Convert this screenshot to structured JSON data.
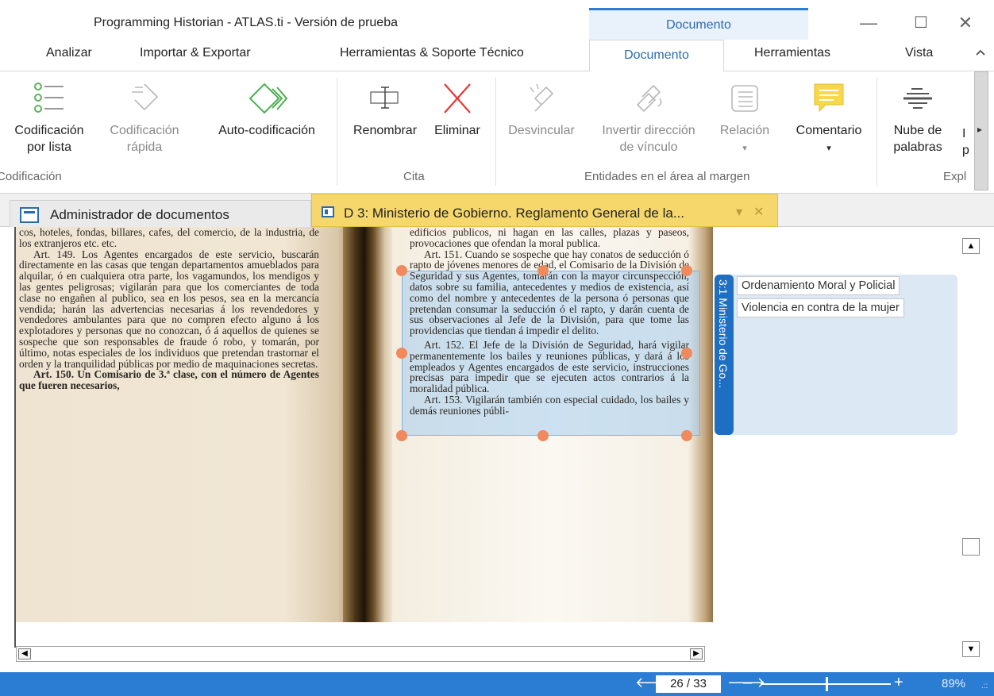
{
  "window": {
    "title": "Programming Historian - ATLAS.ti - Versión de prueba",
    "context_tab": "Documento",
    "minimize": "—",
    "maximize": "☐",
    "close": "✕"
  },
  "menu": {
    "tabs": [
      "Analizar",
      "Importar & Exportar",
      "Herramientas & Soporte Técnico",
      "Documento",
      "Herramientas",
      "Vista"
    ],
    "active": "Documento",
    "collapse_icon": "chevron-up-icon"
  },
  "ribbon": {
    "buttons": [
      {
        "line1": "Codificación",
        "line2": "por lista",
        "icon": "code-list-icon"
      },
      {
        "line1": "Codificación",
        "line2": "rápida",
        "icon": "quick-code-icon"
      },
      {
        "line1": "Auto-codificación",
        "line2": "",
        "icon": "auto-code-icon"
      },
      {
        "line1": "Renombrar",
        "line2": "",
        "icon": "rename-icon"
      },
      {
        "line1": "Eliminar",
        "line2": "",
        "icon": "delete-icon"
      },
      {
        "line1": "Desvincular",
        "line2": "",
        "icon": "unlink-icon"
      },
      {
        "line1": "Invertir dirección",
        "line2": "de vínculo",
        "icon": "reverse-link-icon"
      },
      {
        "line1": "Relación",
        "line2": "▾",
        "icon": "relation-icon"
      },
      {
        "line1": "Comentario",
        "line2": "▾",
        "icon": "comment-icon"
      },
      {
        "line1": "Nube de",
        "line2": "palabras",
        "icon": "word-cloud-icon"
      },
      {
        "line1": "I",
        "line2": "p",
        "icon": ""
      }
    ],
    "groups": [
      "Codificación",
      "Cita",
      "Entidades en el área al margen",
      "Expl"
    ],
    "more": "▸"
  },
  "doc_tabs": {
    "manager": "Administrador de documentos",
    "document": "D 3: Ministerio de Gobierno. Reglamento General de la...",
    "dropdown": "▾",
    "close": "✕"
  },
  "document": {
    "left_column": [
      "cos, hoteles, fondas, billares, cafes, del comercio, de la industria, de los extranjeros etc. etc.",
      "Art. 149. Los Agentes encargados de este servicio, buscarán directamente en las casas que tengan departamentos amueblados para alquilar, ó en cualquiera otra parte, los vagamundos, los mendigos y las gentes peligrosas; vigilarán para que los comerciantes de toda clase no engañen al publico, sea en los pesos, sea en la mercancía vendida; harán las advertencias necesarias á los revendedores y vendedores ambulantes para que no compren efecto alguno á los explotadores y personas que no conozcan, ó á aquellos de quienes se sospeche que son responsables de fraude ó robo, y tomarán, por último, notas especiales de los individuos que pretendan trastornar el orden y la tranquilidad públicas por medio de maquinaciones secretas.",
      "Art. 150. Un Comisario de 3.ª clase, con el número de Agentes que fueren necesarios,"
    ],
    "right_column": [
      "edificios publicos, ni hagan en las calles, plazas y paseos, provocaciones que ofendan la moral publica.",
      "Art. 151. Cuando se sospeche que hay conatos de seducción ó rapto de jóvenes menores de edad, el Comisario de la División de Seguridad y sus Agentes, tomarán con la mayor circunspección, datos sobre su familia, antecedentes y medios de existencia, así como del nombre y antecedentes de la persona ó personas que pretendan consumar la seducción ó el rapto, y darán cuenta de sus observaciones al Jefe de la División, para que tome las providencias que tiendan á impedir el delito.",
      "Art. 152. El Jefe de la División de Seguridad, hará vigilar permanentemente los bailes y reuniones públicas, y dará á los empleados y Agentes encargados de este servicio, instrucciones precisas para impedir que se ejecuten actos contrarios á la moralidad pública.",
      "Art. 153. Vigilarán también con especial cuidado, los bailes y demás reuniones públi-"
    ]
  },
  "margin": {
    "quotation_label": "3:1 Ministerio de Go...",
    "codes": [
      "Ordenamiento Moral y Policial",
      "Violencia en contra de la mujer"
    ],
    "colors": {
      "quotation": "#1e6fc2",
      "band": "#dce8f3",
      "handle": "#f08a5d"
    }
  },
  "scroll": {
    "left": "◀",
    "right": "▶",
    "up": "▲",
    "down": "▼"
  },
  "status": {
    "prev": "🡐",
    "page": "26 / 33",
    "next": "🡒",
    "zoom_minus": "–",
    "zoom_plus": "+",
    "zoom": "89%",
    "zoom_fraction": 0.5,
    "grip": ".::"
  },
  "colors": {
    "accent": "#2b7cd3",
    "doc_tab": "#f6d76b"
  }
}
